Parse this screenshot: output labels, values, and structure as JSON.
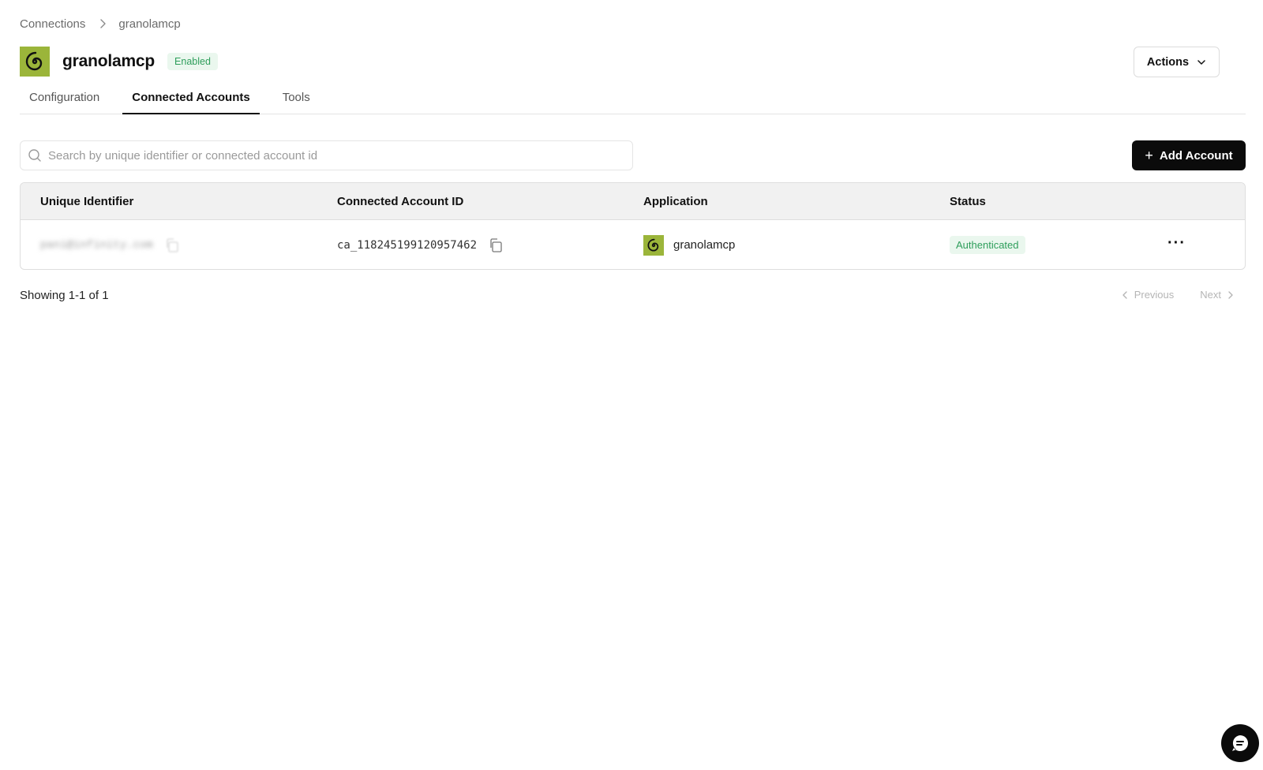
{
  "breadcrumb": {
    "parent": "Connections",
    "current": "granolamcp"
  },
  "header": {
    "title": "granolamcp",
    "status": "Enabled",
    "actions_label": "Actions",
    "logo_icon": "spiral-icon"
  },
  "tabs": [
    {
      "label": "Configuration",
      "active": false
    },
    {
      "label": "Connected Accounts",
      "active": true
    },
    {
      "label": "Tools",
      "active": false
    }
  ],
  "search": {
    "placeholder": "Search by unique identifier or connected account id",
    "value": ""
  },
  "add_account_label": "Add Account",
  "table": {
    "columns": [
      "Unique Identifier",
      "Connected Account ID",
      "Application",
      "Status"
    ],
    "rows": [
      {
        "unique_identifier": "pani@infinity.com",
        "connected_account_id": "ca_118245199120957462",
        "application": "granolamcp",
        "status": "Authenticated"
      }
    ]
  },
  "pagination": {
    "showing": "Showing 1-1 of 1",
    "previous": "Previous",
    "next": "Next"
  },
  "colors": {
    "brand_green": "#9bb53a",
    "success_text": "#2e9e5b",
    "success_bg": "#eaf7ee",
    "primary_button": "#0b0b0b"
  }
}
